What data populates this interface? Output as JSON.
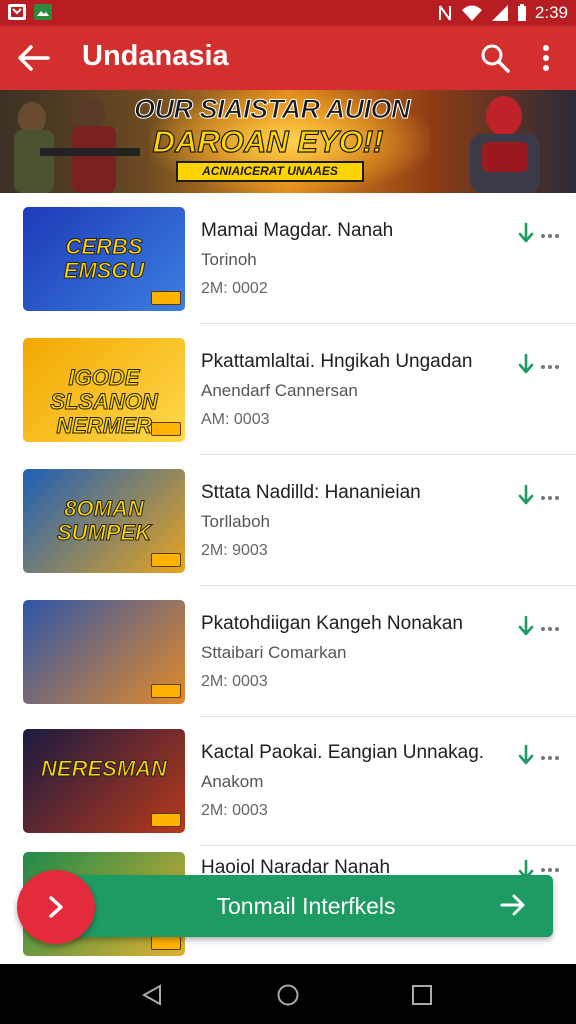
{
  "status_bar": {
    "time": "2:39"
  },
  "app_bar": {
    "title": "Undanasia",
    "back_icon": "arrow-back-icon",
    "search_icon": "search-icon",
    "more_icon": "more-vert-icon"
  },
  "banner": {
    "line1": "OUR SIAISTAR AUION",
    "line2": "DAROAN EYO!!",
    "tag": "ACNIAICERAT UNAAES"
  },
  "apps": [
    {
      "name": "Mamai Magdar. Nanah",
      "developer": "Torinoh",
      "size": "2M: 0002",
      "thumb_text": "CERBS EMSGU",
      "thumb_colors": [
        "#1e3ab8",
        "#3b7fe0"
      ]
    },
    {
      "name": "Pkattamlaltai. Hngikah Ungadan",
      "developer": "Anendarf Cannersan",
      "size": "AM: 0003",
      "thumb_text": "IGODE SLSANON NERMER",
      "thumb_colors": [
        "#f2a800",
        "#ffd84a"
      ]
    },
    {
      "name": "Sttata Nadilld: Hananieian",
      "developer": "Torllaboh",
      "size": "2M: 9003",
      "thumb_text": "8OMAN SUMPEK",
      "thumb_colors": [
        "#1c5fb8",
        "#e8a520"
      ]
    },
    {
      "name": "Pkatohdiigan Kangeh Nonakan",
      "developer": "Sttaibari Comarkan",
      "size": "2M: 0003",
      "thumb_text": "",
      "thumb_colors": [
        "#2d54a8",
        "#e48a2a"
      ]
    },
    {
      "name": "Kactal Paokai. Eangian Unnakag.",
      "developer": "Anakom",
      "size": "2M: 0003",
      "thumb_text": "NERESMAN",
      "thumb_colors": [
        "#1a1a40",
        "#b83a1a"
      ]
    },
    {
      "name": "Haoiol Naradar Nanah",
      "developer": "",
      "size": "",
      "thumb_text": "",
      "thumb_colors": [
        "#1e8a4a",
        "#e0b030"
      ]
    }
  ],
  "cta": {
    "label": "Tonmail Interfkels"
  },
  "colors": {
    "primary": "#d32f2f",
    "status": "#b81d22",
    "cta": "#1e9a63",
    "fab": "#e32b3c",
    "download": "#1e9a63"
  }
}
